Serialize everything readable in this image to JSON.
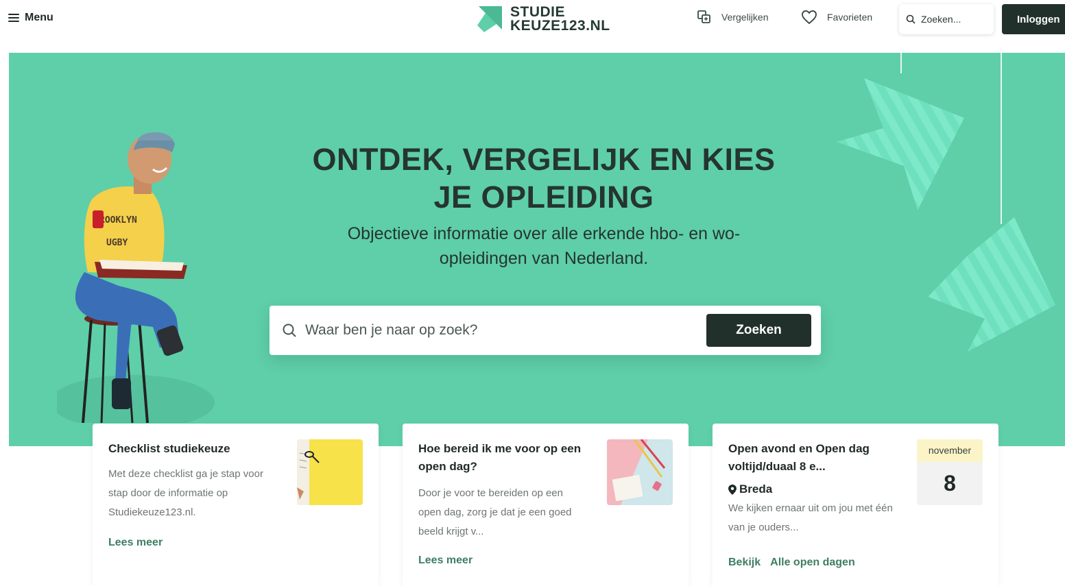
{
  "header": {
    "menu_label": "Menu",
    "logo_line1": "STUDIE",
    "logo_line2": "KEUZE123.NL",
    "compare_label": "Vergelijken",
    "favorites_label": "Favorieten",
    "search_placeholder": "Zoeken...",
    "login_label": "Inloggen"
  },
  "hero": {
    "title_line1": "ONTDEK, VERGELIJK EN KIES",
    "title_line2": "JE OPLEIDING",
    "subtitle": "Objectieve informatie over alle erkende hbo- en wo-opleidingen van Nederland.",
    "search_placeholder": "Waar ben je naar op zoek?",
    "search_button": "Zoeken",
    "shirt_text_1": "ROOKLYN",
    "shirt_text_2": "UGBY"
  },
  "cards": [
    {
      "title": "Checklist studiekeuze",
      "text": "Met deze checklist ga je stap voor stap door de informatie op Studiekeuze123.nl.",
      "link": "Lees meer"
    },
    {
      "title": "Hoe bereid ik me voor op een open dag?",
      "text": "Door je voor te bereiden op een open dag, zorg je dat je een goed beeld krijgt v...",
      "link": "Lees meer"
    },
    {
      "title": "Open avond en Open dag voltijd/duaal 8 e...",
      "location": "Breda",
      "text": "We kijken ernaar uit om jou met één van je ouders...",
      "date_month": "november",
      "date_day": "8",
      "link_view": "Bekijk",
      "link_all": "Alle open dagen"
    }
  ],
  "colors": {
    "hero_bg": "#5ecfa9",
    "dark": "#21302b",
    "link_green": "#3e7d62",
    "logo_green": "#5ecfa9"
  }
}
